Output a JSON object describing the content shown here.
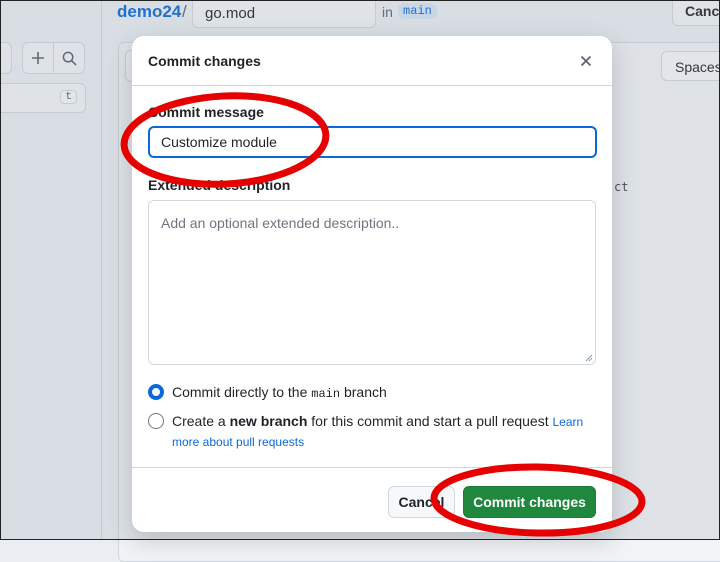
{
  "header": {
    "repo_name": "demo24",
    "separator": "/",
    "filename": "go.mod",
    "in_text": "in",
    "branch": "main",
    "cancel_label": "Cancel"
  },
  "sidebar": {
    "filter_hint": "t"
  },
  "editor": {
    "indent_select": "Spaces",
    "code_fragment": "ct"
  },
  "dialog": {
    "title": "Commit changes",
    "commit_message_label": "Commit message",
    "commit_message_value": "Customize module",
    "extended_description_label": "Extended description",
    "extended_description_placeholder": "Add an optional extended description..",
    "option_direct": {
      "prefix": "Commit directly to the ",
      "branch": "main",
      "suffix": " branch",
      "checked": true
    },
    "option_new_branch": {
      "prefix": "Create a ",
      "bold": "new branch",
      "suffix": " for this commit and start a pull request ",
      "link_part1": "Learn",
      "link_part2": "more about pull requests",
      "checked": false
    },
    "cancel_label": "Cancel",
    "commit_label": "Commit changes"
  },
  "colors": {
    "accent": "#0969da",
    "primary_button": "#1f883d",
    "annotation": "#e60000"
  },
  "icons": {
    "close": "close-icon",
    "plus": "plus-icon",
    "search": "search-icon"
  }
}
